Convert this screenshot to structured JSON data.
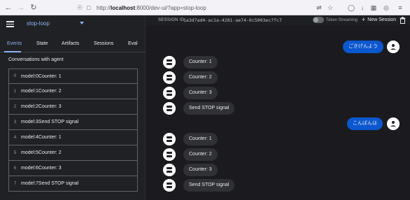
{
  "browser": {
    "url_prefix": "http://",
    "url_host": "localhost",
    "url_rest": ":8000/dev-ui/?app=stop-loop"
  },
  "sidebar": {
    "app_name": "stop-loop",
    "tabs": [
      {
        "label": "Events"
      },
      {
        "label": "State"
      },
      {
        "label": "Artifacts"
      },
      {
        "label": "Sessions"
      },
      {
        "label": "Eval"
      }
    ],
    "conversations_heading": "Conversations with agent",
    "events": [
      {
        "index": "0",
        "text": "model:0Counter: 1"
      },
      {
        "index": "1",
        "text": "model:1Counter: 2"
      },
      {
        "index": "2",
        "text": "model:2Counter: 3"
      },
      {
        "index": "3",
        "text": "model:3Send STOP signal"
      },
      {
        "index": "4",
        "text": "model:4Counter: 1"
      },
      {
        "index": "5",
        "text": "model:5Counter: 2"
      },
      {
        "index": "6",
        "text": "model:6Counter: 3"
      },
      {
        "index": "7",
        "text": "model:7Send STOP signal"
      }
    ]
  },
  "header": {
    "session_label": "SESSION ID",
    "session_id": "1a3d7ad4-ac1a-4281-ae74-0c5003ec7fc7",
    "token_streaming_label": "Token Streaming",
    "new_session_label": "New Session"
  },
  "chat": {
    "user_messages": [
      "ごきげんよう",
      "こんばんは"
    ],
    "bot_messages": [
      "Counter: 1",
      "Counter: 2",
      "Counter: 3",
      "Send STOP signal",
      "Counter: 1",
      "Counter: 2",
      "Counter: 3",
      "Send STOP signal"
    ]
  },
  "colors": {
    "accent": "#8ab4f8",
    "user_bubble": "#0b57d0",
    "bot_bubble": "#303134",
    "background": "#1b1b1f"
  },
  "icons": [
    "back-arrow-icon",
    "forward-arrow-icon",
    "reload-icon",
    "shield-icon",
    "lock-icon",
    "translate-icon",
    "bookmark-star-icon",
    "pocket-icon",
    "download-icon",
    "extensions-icon",
    "account-icon",
    "menu-icon",
    "hamburger-icon",
    "chevron-down-icon",
    "plus-icon",
    "trash-icon",
    "person-icon",
    "bot-icon"
  ]
}
